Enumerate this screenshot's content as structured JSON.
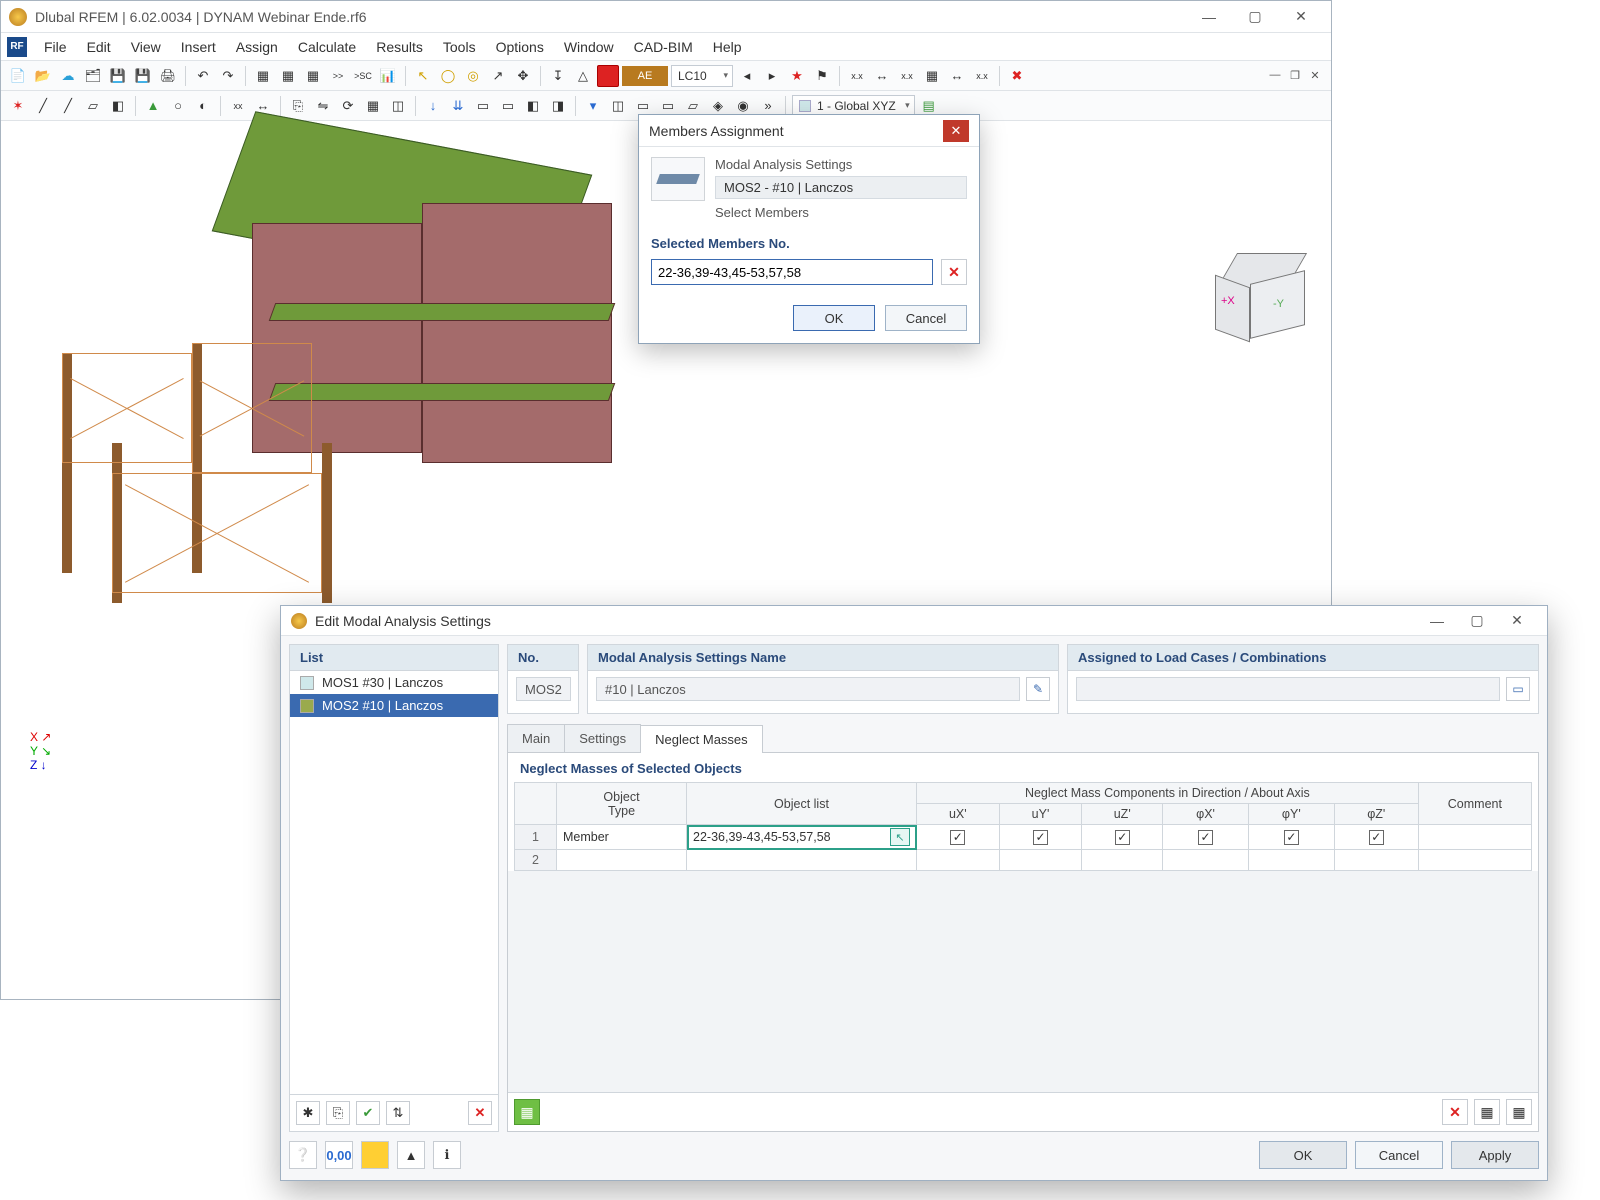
{
  "app": {
    "title": "Dlubal RFEM | 6.02.0034 | DYNAM Webinar Ende.rf6",
    "menus": [
      "File",
      "Edit",
      "View",
      "Insert",
      "Assign",
      "Calculate",
      "Results",
      "Tools",
      "Options",
      "Window",
      "CAD-BIM",
      "Help"
    ],
    "load_case_badge": "AE",
    "load_case": "LC10",
    "coord_system": "1 - Global XYZ"
  },
  "members_dialog": {
    "title": "Members Assignment",
    "label_settings": "Modal Analysis Settings",
    "settings_value": "MOS2 - #10 | Lanczos",
    "label_select_members": "Select Members",
    "section": "Selected Members No.",
    "input_value": "22-36,39-43,45-53,57,58",
    "ok": "OK",
    "cancel": "Cancel"
  },
  "modal_dialog": {
    "title": "Edit Modal Analysis Settings",
    "list_header": "List",
    "list": [
      {
        "swatch": "#cfe8ea",
        "label": "MOS1  #30 | Lanczos",
        "selected": false
      },
      {
        "swatch": "#9aaa4d",
        "label": "MOS2  #10 | Lanczos",
        "selected": true
      }
    ],
    "no_header": "No.",
    "no_value": "MOS2",
    "name_header": "Modal Analysis Settings Name",
    "name_value": "#10 | Lanczos",
    "assigned_header": "Assigned to Load Cases / Combinations",
    "assigned_value": "",
    "tabs": [
      "Main",
      "Settings",
      "Neglect Masses"
    ],
    "active_tab": 2,
    "tabpage_header": "Neglect Masses of Selected Objects",
    "table": {
      "group_header": "Neglect Mass Components in Direction / About Axis",
      "cols_object": "Object\nType",
      "cols_list": "Object list",
      "cols_dirs": [
        "uX'",
        "uY'",
        "uZ'",
        "φX'",
        "φY'",
        "φZ'"
      ],
      "cols_comment": "Comment",
      "rows": [
        {
          "num": "1",
          "type": "Member",
          "list": "22-36,39-43,45-53,57,58",
          "checks": [
            true,
            true,
            true,
            true,
            true,
            true
          ],
          "comment": ""
        },
        {
          "num": "2",
          "type": "",
          "list": "",
          "checks": [
            null,
            null,
            null,
            null,
            null,
            null
          ],
          "comment": ""
        }
      ]
    },
    "ok": "OK",
    "cancel": "Cancel",
    "apply": "Apply"
  }
}
